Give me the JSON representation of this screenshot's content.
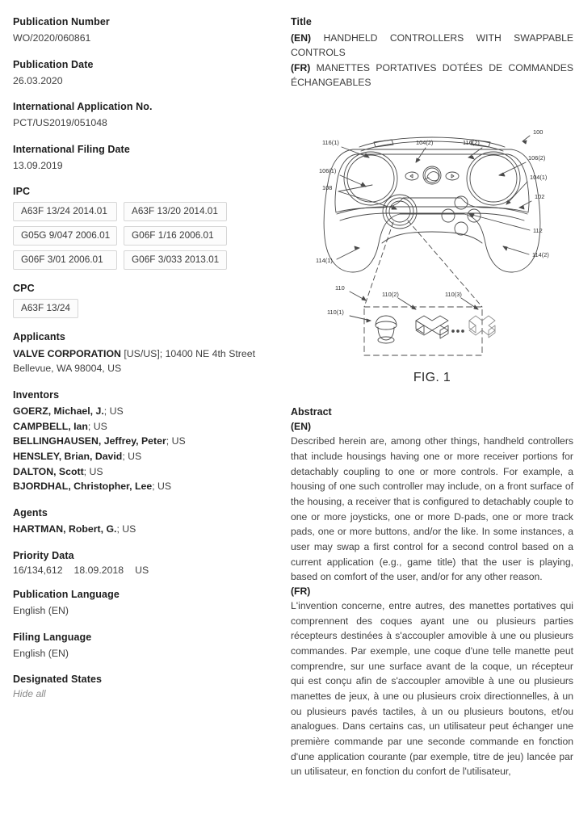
{
  "left": {
    "publication_number": {
      "label": "Publication Number",
      "value": "WO/2020/060861"
    },
    "publication_date": {
      "label": "Publication Date",
      "value": "26.03.2020"
    },
    "international_application_no": {
      "label": "International Application No.",
      "value": "PCT/US2019/051048"
    },
    "international_filing_date": {
      "label": "International Filing Date",
      "value": "13.09.2019"
    },
    "ipc": {
      "label": "IPC",
      "codes": [
        "A63F 13/24 2014.01",
        "A63F 13/20 2014.01",
        "G05G 9/047 2006.01",
        "G06F 1/16 2006.01",
        "G06F 3/01 2006.01",
        "G06F 3/033 2013.01"
      ]
    },
    "cpc": {
      "label": "CPC",
      "codes": [
        "A63F 13/24"
      ]
    },
    "applicants": {
      "label": "Applicants",
      "name": "VALVE CORPORATION",
      "detail": " [US/US]; 10400 NE 4th Street",
      "line2": "Bellevue, WA 98004, US"
    },
    "inventors": {
      "label": "Inventors",
      "list": [
        {
          "surname": "GOERZ, Michael, J.",
          "rest": "; US"
        },
        {
          "surname": "CAMPBELL, Ian",
          "rest": "; US"
        },
        {
          "surname": "BELLINGHAUSEN, Jeffrey, Peter",
          "rest": "; US"
        },
        {
          "surname": "HENSLEY, Brian, David",
          "rest": "; US"
        },
        {
          "surname": "DALTON, Scott",
          "rest": "; US"
        },
        {
          "surname": "BJORDHAL, Christopher, Lee",
          "rest": "; US"
        }
      ]
    },
    "agents": {
      "label": "Agents",
      "list": [
        {
          "surname": "HARTMAN, Robert, G.",
          "rest": "; US"
        }
      ]
    },
    "priority_data": {
      "label": "Priority Data",
      "number": "16/134,612",
      "date": "18.09.2018",
      "country": "US"
    },
    "publication_language": {
      "label": "Publication Language",
      "value": "English (EN)"
    },
    "filing_language": {
      "label": "Filing Language",
      "value": "English (EN)"
    },
    "designated_states": {
      "label": "Designated States",
      "toggle": "Hide all"
    }
  },
  "right": {
    "title": {
      "label": "Title",
      "en_tag": "(EN)",
      "en_text": "HANDHELD CONTROLLERS WITH SWAPPABLE CONTROLS",
      "fr_tag": "(FR)",
      "fr_text": "MANETTES PORTATIVES DOTÉES DE COMMANDES ÉCHANGEABLES"
    },
    "figure": {
      "caption": "FIG. 1",
      "alt": "patent-line-drawing-handheld-controller",
      "numerals": [
        "100",
        "102",
        "104(1)",
        "104(2)",
        "106(1)",
        "106(2)",
        "108",
        "110",
        "110(1)",
        "110(2)",
        "110(3)",
        "112",
        "114(1)",
        "114(2)",
        "116(1)",
        "116(2)"
      ]
    },
    "abstract": {
      "label": "Abstract",
      "en_tag": "(EN)",
      "en_text": "Described herein are, among other things, handheld controllers that include housings having one or more receiver portions for detachably coupling to one or more controls. For example, a housing of one such controller may include, on a front surface of the housing, a receiver that is configured to detachably couple to one or more joysticks, one or more D-pads, one or more track pads, one or more buttons, and/or the like. In some instances, a user may swap a first control for a second control based on a current application (e.g., game title) that the user is playing, based on comfort of the user, and/or for any other reason.",
      "fr_tag": "(FR)",
      "fr_text": "L'invention concerne, entre autres, des manettes portatives qui comprennent des coques ayant une ou plusieurs parties récepteurs destinées à s'accoupler amovible à une ou plusieurs commandes. Par exemple, une coque d'une telle manette peut comprendre, sur une surface avant de la coque, un récepteur qui est conçu afin de s'accoupler amovible à une ou plusieurs manettes de jeux, à une ou plusieurs croix directionnelles, à un ou plusieurs pavés tactiles, à un ou plusieurs boutons, et/ou analogues. Dans certains cas, un utilisateur peut échanger une première commande par une seconde commande en fonction d'une application courante (par exemple, titre de jeu) lancée par un utilisateur, en fonction du confort de l'utilisateur,"
    }
  },
  "colors": {
    "heading": "#1c1c1c",
    "body": "#3f3f3f",
    "muted": "#8a8a8a",
    "chip_border": "#d6d6d6",
    "drawing": "#4a4a4a"
  }
}
